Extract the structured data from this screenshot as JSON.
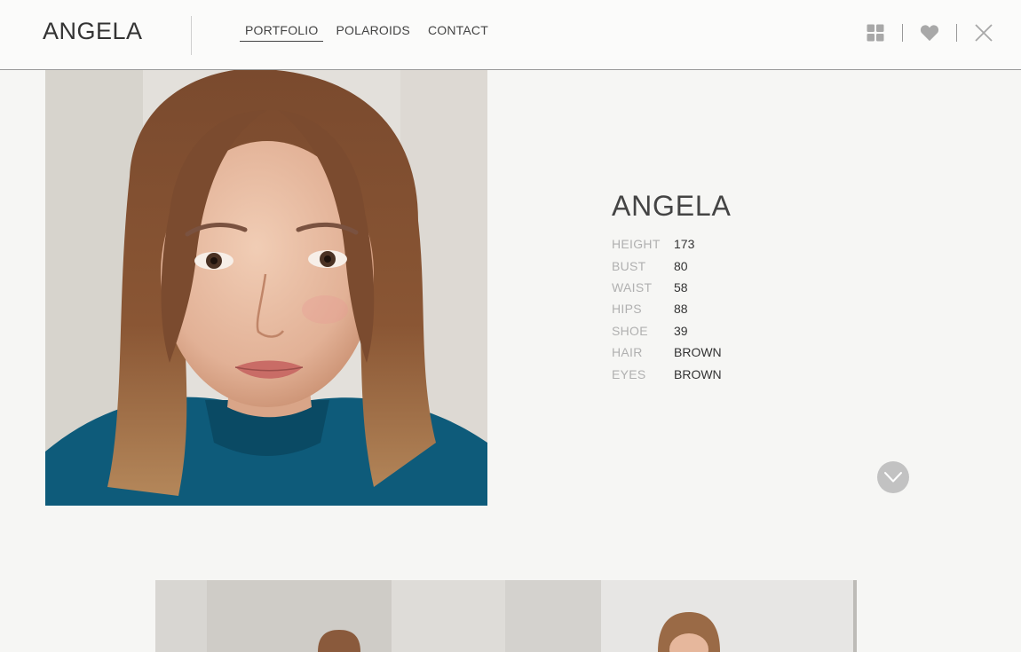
{
  "header": {
    "brand": "ANGELA",
    "nav": [
      {
        "label": "PORTFOLIO",
        "active": true
      },
      {
        "label": "POLAROIDS",
        "active": false
      },
      {
        "label": "CONTACT",
        "active": false
      }
    ],
    "icons": [
      "grid-icon",
      "heart-icon",
      "close-icon"
    ]
  },
  "model": {
    "name": "ANGELA",
    "stats": [
      {
        "label": "HEIGHT",
        "value": "173"
      },
      {
        "label": "BUST",
        "value": "80"
      },
      {
        "label": "WAIST",
        "value": "58"
      },
      {
        "label": "HIPS",
        "value": "88"
      },
      {
        "label": "SHOE",
        "value": "39"
      },
      {
        "label": "HAIR",
        "value": "BROWN"
      },
      {
        "label": "EYES",
        "value": "BROWN"
      }
    ]
  },
  "colors": {
    "background": "#f6f6f4",
    "text": "#333333",
    "label": "#b0b0b0",
    "icon": "#a8a8a8",
    "scroll_button": "#c2c2c2"
  }
}
